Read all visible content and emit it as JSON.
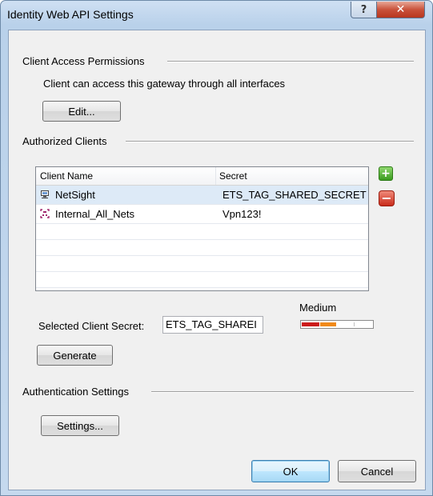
{
  "window": {
    "title": "Identity Web API Settings",
    "help_label": "?",
    "close_label": "✕"
  },
  "client_access": {
    "title": "Client Access Permissions",
    "description": "Client can access this gateway through all interfaces",
    "edit_label": "Edit..."
  },
  "authorized_clients": {
    "title": "Authorized Clients",
    "columns": [
      "Client Name",
      "Secret"
    ],
    "rows": [
      {
        "icon": "computer-icon",
        "name": "NetSight",
        "secret": "ETS_TAG_SHARED_SECRET",
        "selected": true
      },
      {
        "icon": "network-group-icon",
        "name": "Internal_All_Nets",
        "secret": "Vpn123!",
        "selected": false
      }
    ],
    "add_icon": "+",
    "remove_icon": "−"
  },
  "selected_secret": {
    "label": "Selected Client Secret:",
    "value": "ETS_TAG_SHAREI",
    "strength_label": "Medium",
    "strength_fraction": 0.5,
    "generate_label": "Generate"
  },
  "authentication": {
    "title": "Authentication Settings",
    "settings_label": "Settings..."
  },
  "footer": {
    "ok_label": "OK",
    "cancel_label": "Cancel"
  },
  "colors": {
    "strength_red": "#cc1b1b",
    "strength_orange": "#f08a1a",
    "selected_row": "#ddeaf7"
  }
}
